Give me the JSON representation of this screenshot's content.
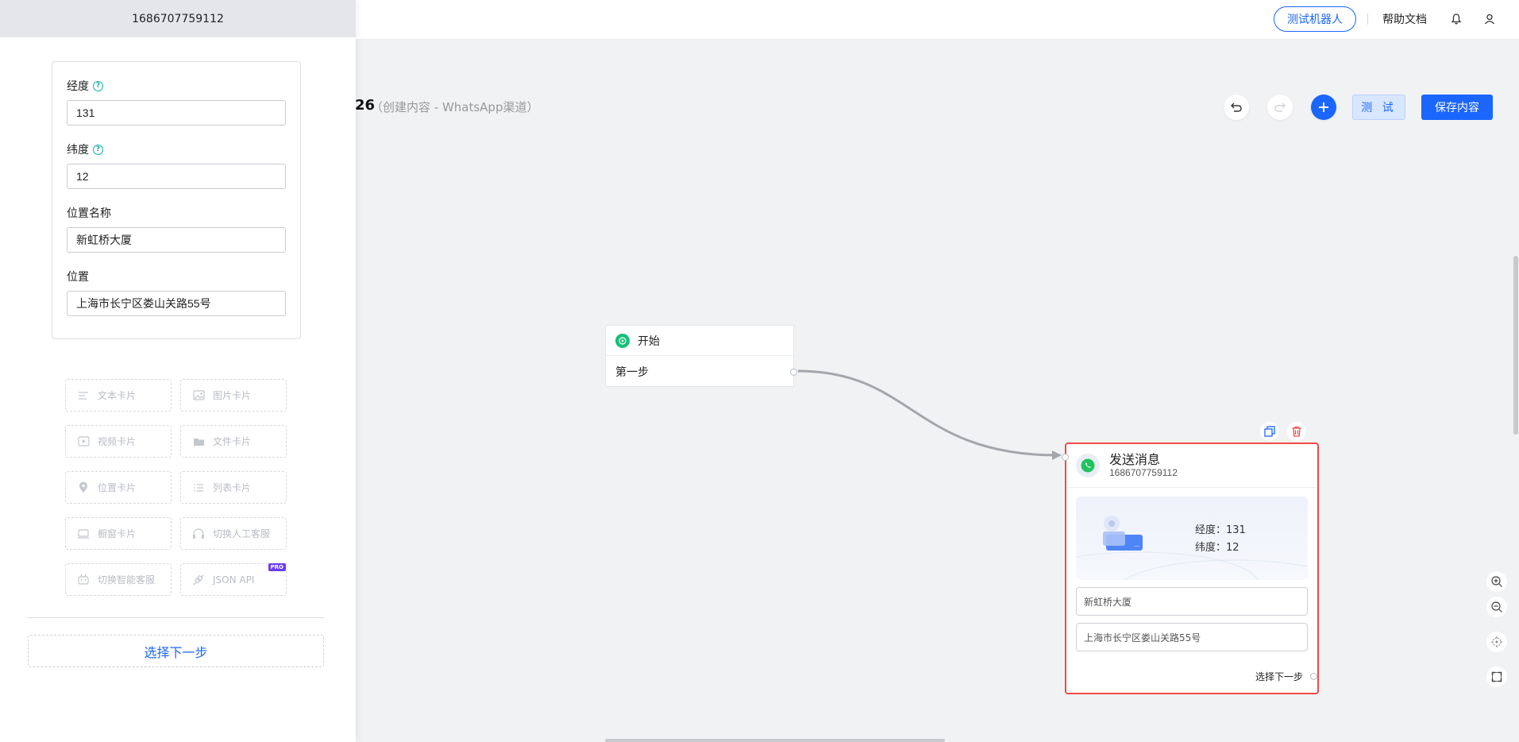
{
  "topbar": {
    "test_bot_label": "测试机器人",
    "help_label": "帮助文档",
    "icons": [
      "bell-icon",
      "user-icon"
    ]
  },
  "canvas": {
    "title_fragment": "26",
    "subtitle": "（创建内容 - WhatsApp渠道）",
    "test_label": "测 试",
    "save_label": "保存内容",
    "accent_color": "#1b66ff"
  },
  "panel": {
    "header": "1686707759112",
    "fields": {
      "longitude_label": "经度",
      "longitude_value": "131",
      "latitude_label": "纬度",
      "latitude_value": "12",
      "place_name_label": "位置名称",
      "place_name_value": "新虹桥大厦",
      "address_label": "位置",
      "address_value": "上海市长宁区娄山关路55号"
    },
    "cards": [
      {
        "label": "文本卡片",
        "icon": "text-icon"
      },
      {
        "label": "图片卡片",
        "icon": "image-icon"
      },
      {
        "label": "视频卡片",
        "icon": "video-icon"
      },
      {
        "label": "文件卡片",
        "icon": "folder-icon"
      },
      {
        "label": "位置卡片",
        "icon": "location-icon"
      },
      {
        "label": "列表卡片",
        "icon": "list-icon"
      },
      {
        "label": "橱窗卡片",
        "icon": "showcase-icon"
      },
      {
        "label": "切换人工客服",
        "icon": "headset-icon"
      },
      {
        "label": "切换智能客服",
        "icon": "robot-icon"
      },
      {
        "label": "JSON API",
        "icon": "plug-icon",
        "badge": "PRO"
      }
    ],
    "next_step_label": "选择下一步"
  },
  "start_node": {
    "title": "开始",
    "step": "第一步"
  },
  "message_node": {
    "title": "发送消息",
    "id": "1686707759112",
    "longitude_line": "经度：131",
    "latitude_line": "纬度：12",
    "place_name": "新虹桥大厦",
    "address": "上海市长宁区娄山关路55号",
    "next_step_label": "选择下一步",
    "border_color": "#ef4b4b"
  }
}
